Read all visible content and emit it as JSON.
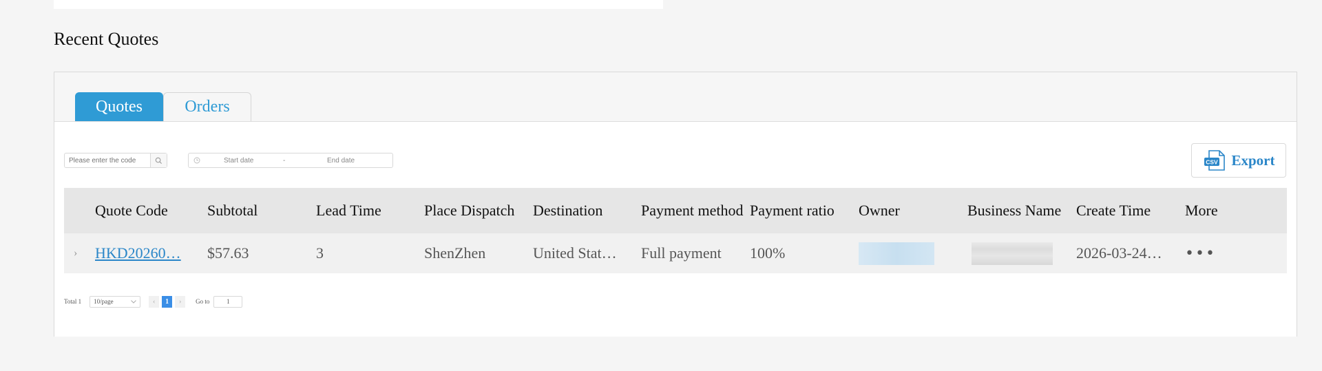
{
  "section": {
    "title": "Recent Quotes"
  },
  "tabs": [
    {
      "label": "Quotes",
      "active": true
    },
    {
      "label": "Orders",
      "active": false
    }
  ],
  "filters": {
    "search_placeholder": "Please enter the code",
    "start_placeholder": "Start date",
    "separator": "-",
    "end_placeholder": "End date"
  },
  "export": {
    "label": "Export",
    "icon_text": "CSV"
  },
  "table": {
    "headers": [
      "Quote Code",
      "Subtotal",
      "Lead Time",
      "Place Dispatch",
      "Destination",
      "Payment method",
      "Payment ratio",
      "Owner",
      "Business Name",
      "Create Time",
      "More"
    ],
    "rows": [
      {
        "expand": "›",
        "quote_code": "HKD20260…",
        "subtotal": "$57.63",
        "lead_time": "3",
        "place_dispatch": "ShenZhen",
        "destination": "United Stat…",
        "payment_method": "Full payment",
        "payment_ratio": "100%",
        "create_time": "2026-03-24…",
        "more": "•••"
      }
    ]
  },
  "pagination": {
    "total_label": "Total 1",
    "page_size": "10/page",
    "prev": "‹",
    "current_page": "1",
    "next": "›",
    "goto_label": "Go to",
    "goto_value": "1"
  },
  "colors": {
    "accent": "#2f9bd5",
    "link": "#2a86c8",
    "page_active": "#3a8ee6"
  }
}
